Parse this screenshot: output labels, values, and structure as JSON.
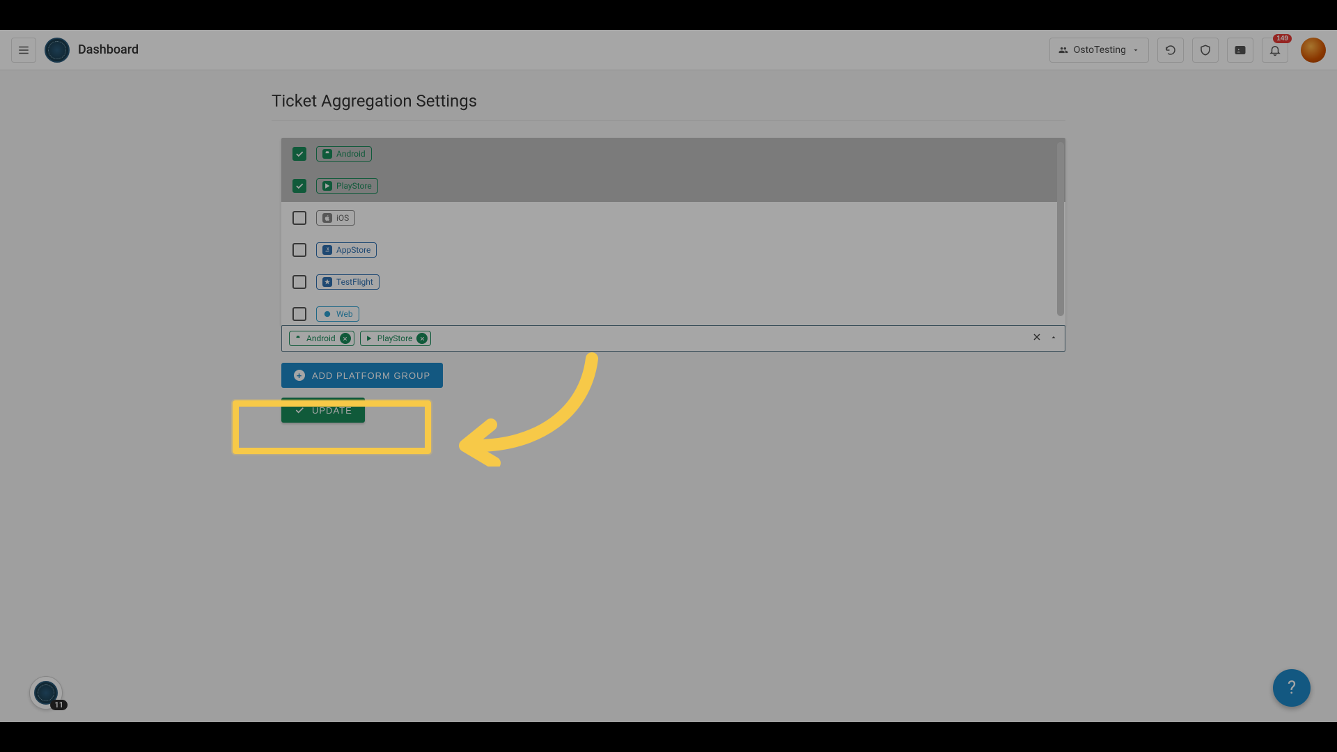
{
  "header": {
    "title": "Dashboard",
    "workspace": "OstoTesting",
    "notificationCount": "149"
  },
  "section": {
    "title": "Ticket Aggregation Settings"
  },
  "platforms": [
    {
      "label": "Android",
      "checked": true,
      "color": "green",
      "icon": "android"
    },
    {
      "label": "PlayStore",
      "checked": true,
      "color": "green",
      "icon": "play"
    },
    {
      "label": "iOS",
      "checked": false,
      "color": "grey",
      "icon": "apple"
    },
    {
      "label": "AppStore",
      "checked": false,
      "color": "blue",
      "icon": "appstore"
    },
    {
      "label": "TestFlight",
      "checked": false,
      "color": "blue",
      "icon": "testflight"
    },
    {
      "label": "Web",
      "checked": false,
      "color": "lblue",
      "icon": "web"
    }
  ],
  "selectedTags": [
    {
      "label": "Android",
      "icon": "android"
    },
    {
      "label": "PlayStore",
      "icon": "play"
    }
  ],
  "buttons": {
    "addPlatformGroup": "ADD PLATFORM GROUP",
    "update": "UPDATE"
  },
  "chatBadge": "11",
  "helpLabel": "?"
}
